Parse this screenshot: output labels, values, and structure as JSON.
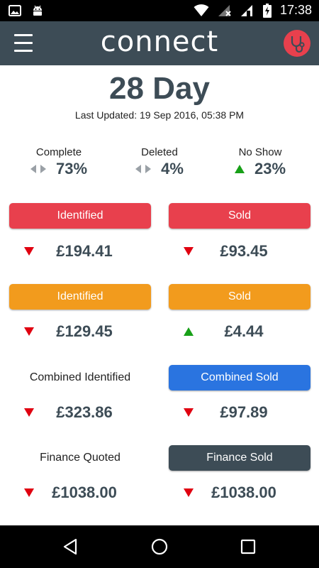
{
  "status_bar": {
    "time": "17:38"
  },
  "app_bar": {
    "logo_text": "connect"
  },
  "header": {
    "title": "28 Day",
    "last_updated": "Last Updated: 19 Sep 2016, 05:38 PM"
  },
  "stats": [
    {
      "label": "Complete",
      "value": "73%",
      "trend": "neutral"
    },
    {
      "label": "Deleted",
      "value": "4%",
      "trend": "neutral"
    },
    {
      "label": "No Show",
      "value": "23%",
      "trend": "up"
    }
  ],
  "cards": {
    "red_identified": {
      "label": "Identified",
      "amount": "£194.41",
      "trend": "down"
    },
    "red_sold": {
      "label": "Sold",
      "amount": "£93.45",
      "trend": "down"
    },
    "orange_identified": {
      "label": "Identified",
      "amount": "£129.45",
      "trend": "down"
    },
    "orange_sold": {
      "label": "Sold",
      "amount": "£4.44",
      "trend": "up"
    },
    "combined_identified": {
      "label": "Combined Identified",
      "amount": "£323.86",
      "trend": "down"
    },
    "combined_sold": {
      "label": "Combined Sold",
      "amount": "£97.89",
      "trend": "down"
    },
    "finance_quoted": {
      "label": "Finance Quoted",
      "amount": "£1038.00",
      "trend": "down"
    },
    "finance_sold": {
      "label": "Finance Sold",
      "amount": "£1038.00",
      "trend": "down"
    }
  },
  "colors": {
    "app_bar": "#3d4c56",
    "red": "#e8404d",
    "orange": "#f29b1d",
    "blue": "#2a74e0",
    "slate": "#3d4c56",
    "trend_down": "#e00010",
    "trend_up": "#18a018",
    "trend_neutral": "#9aa0a6"
  },
  "icons": {
    "status_left": [
      "image-icon",
      "android-icon"
    ],
    "status_right": [
      "wifi-icon",
      "cellular-no-sim-icon",
      "cellular-signal-icon",
      "battery-charging-icon"
    ],
    "app_right": "stethoscope-icon",
    "nav": [
      "back-icon",
      "home-icon",
      "recents-icon"
    ]
  }
}
